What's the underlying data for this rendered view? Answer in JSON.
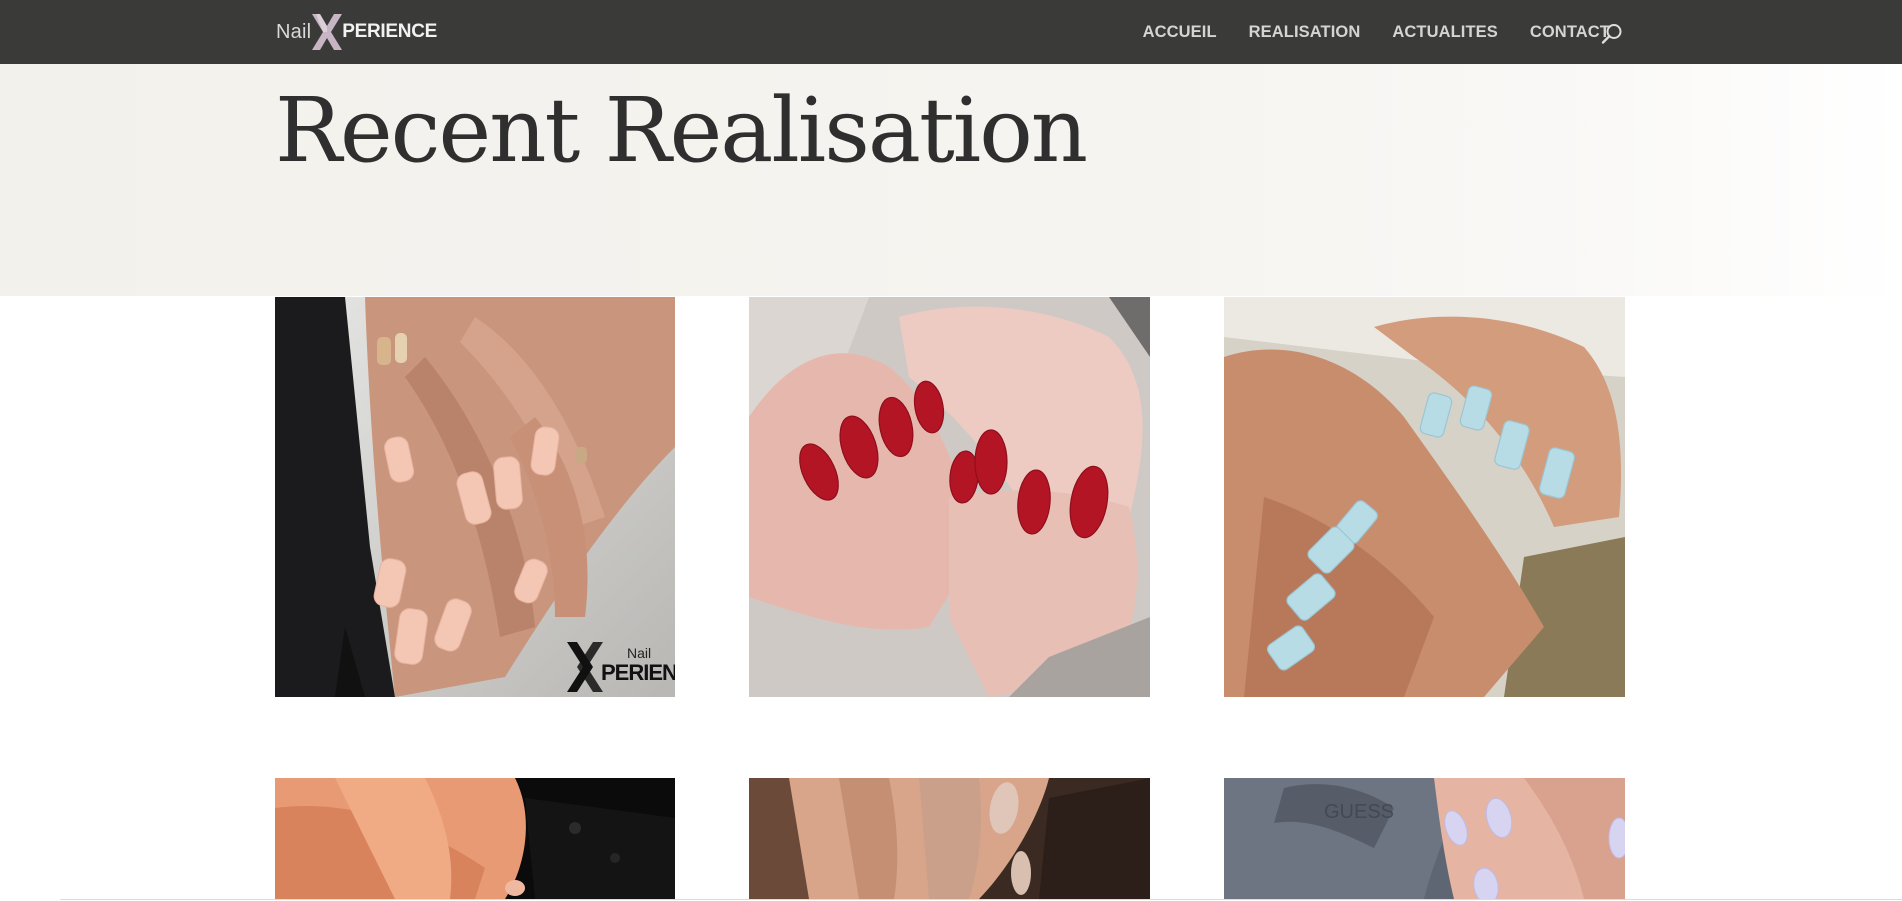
{
  "site": {
    "logo": {
      "part1": "Nail",
      "part2": "X",
      "part3": "PERIENCE"
    },
    "nav": [
      "ACCUEIL",
      "REALISATION",
      "ACTUALITES",
      "CONTACT"
    ],
    "search_icon": "search-icon"
  },
  "hero": {
    "title": "Recent Realisation"
  },
  "gallery": {
    "items": [
      {
        "alt": "nude-matte-coffin-nails",
        "watermark": "Nail XPERIENCE",
        "polish": "#f4c7b4"
      },
      {
        "alt": "red-glossy-almond-nails",
        "polish": "#b31525"
      },
      {
        "alt": "light-blue-square-nails",
        "polish": "#b8dce6"
      },
      {
        "alt": "nails-on-dark-background",
        "polish": "#f0b8a1"
      },
      {
        "alt": "nude-nails-hands",
        "polish": "#d8bfb0"
      },
      {
        "alt": "lavender-nails-grey-sleeve",
        "polish": "#d7d4f2"
      }
    ]
  },
  "colors": {
    "header_bg": "#3a3a39",
    "nav_text": "#d4d4d4",
    "hero_bg": "#f3f1ec",
    "title": "#2f2f2f"
  }
}
